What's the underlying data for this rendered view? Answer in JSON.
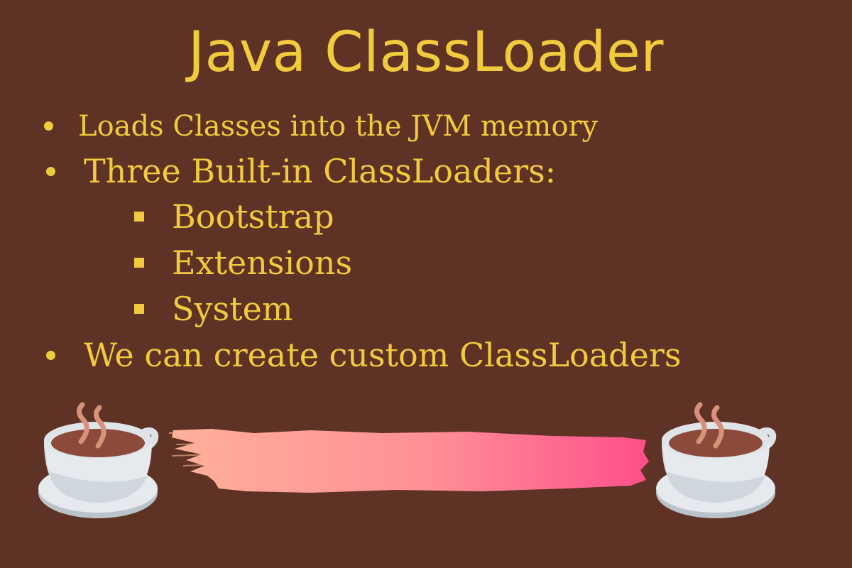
{
  "title": "Java ClassLoader",
  "bullets": [
    "Loads Classes into the JVM memory",
    "Three Built-in ClassLoaders:",
    "We can create custom ClassLoaders"
  ],
  "sub_bullets": [
    "Bootstrap",
    "Extensions",
    "System"
  ],
  "colors": {
    "background": "#5e3224",
    "text": "#f1cb3d",
    "brush_start": "#ffb199",
    "brush_end": "#ff4f8a",
    "coffee": "#8c4a3a",
    "cup": "#e6eaee",
    "steam": "#d9927a"
  },
  "icons": [
    "coffee-cup-icon",
    "coffee-cup-icon"
  ]
}
